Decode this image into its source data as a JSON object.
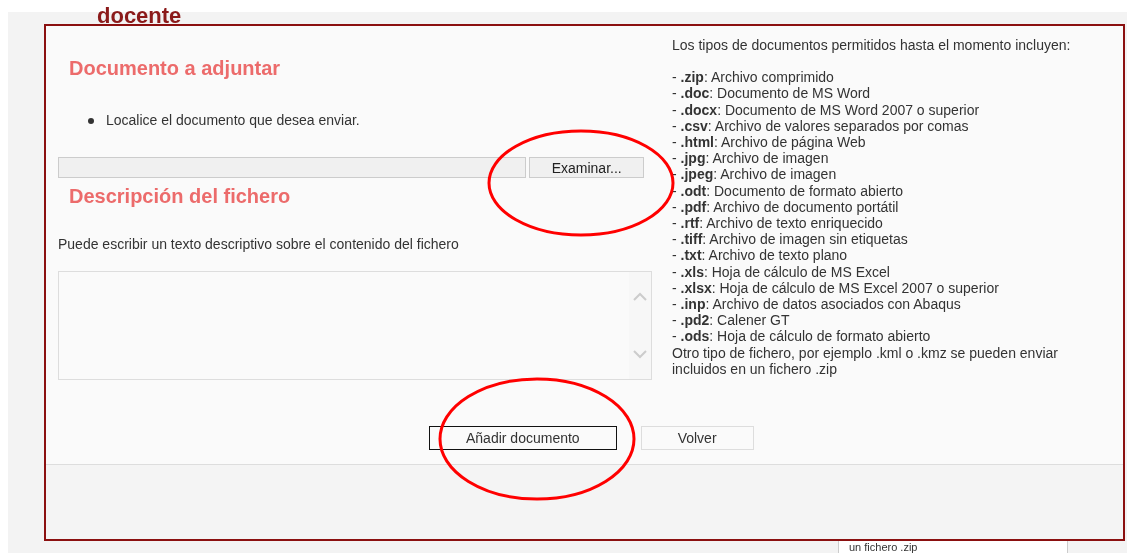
{
  "background_page": {
    "heading": "docente",
    "footer_text": "un fichero .zip"
  },
  "dialog": {
    "attach_section": {
      "heading": "Documento a adjuntar",
      "instructions": [
        "Localice el documento que desea enviar."
      ],
      "file_field": {
        "button": "Examinar..."
      }
    },
    "description_section": {
      "heading": "Descripción del fichero",
      "hint": "Puede escribir un texto descriptivo sobre el contenido del fichero"
    },
    "allowed_types": {
      "intro": "Los tipos de documentos permitidos hasta el momento incluyen:",
      "types": [
        "- **.zip**: Archivo comprimido",
        "- **.doc**: Documento de MS Word",
        "- **.docx**: Documento de MS Word 2007 o superior",
        "- **.csv**: Archivo de valores separados por comas",
        "- **.html**: Archivo de página Web",
        "- **.jpg**: Archivo de imagen",
        "- **.jpeg**: Archivo de imagen",
        "- **.odt**: Documento de formato abierto",
        "- **.pdf**: Archivo de documento portátil",
        "- **.rtf**: Archivo de texto enriquecido",
        "- **.tiff**: Archivo de imagen sin etiquetas",
        "- **.txt**: Archivo de texto plano",
        "- **.xls**: Hoja de cálculo de MS Excel",
        "- **.xlsx**: Hoja de cálculo de MS Excel 2007 o superior",
        "- **.inp**: Archivo de datos asociados con Abaqus",
        "- **.pd2**: Calener GT",
        "- **.ods**: Hoja de cálculo de formato abierto"
      ],
      "note": "Otro tipo de fichero, por ejemplo .kml o .kmz se pueden enviar incluidos en un fichero .zip"
    },
    "buttons": [
      {
        "label": "Añadir documento",
        "focused": true
      },
      {
        "label": "Volver",
        "focused": false
      }
    ]
  }
}
